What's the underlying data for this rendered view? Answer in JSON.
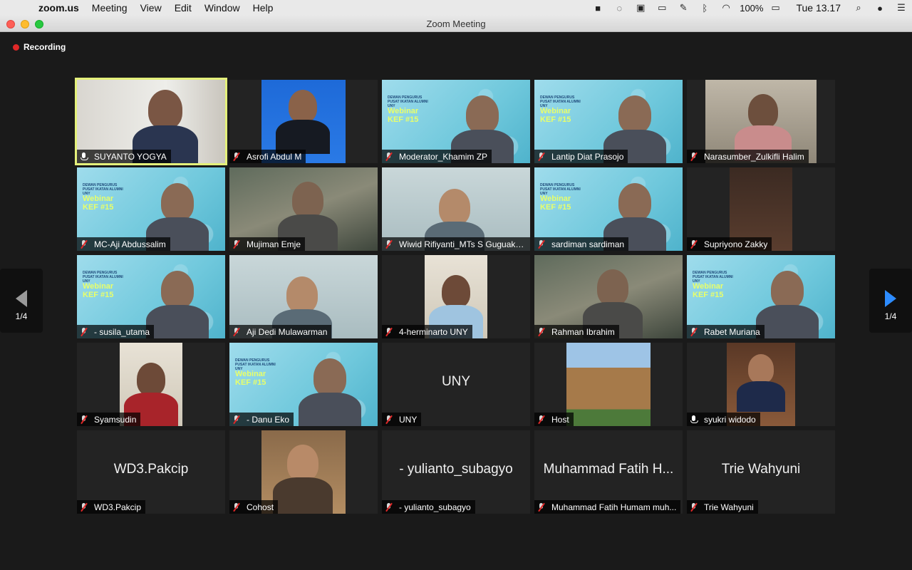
{
  "menubar": {
    "app_name": "zoom.us",
    "menus": [
      "Meeting",
      "View",
      "Edit",
      "Window",
      "Help"
    ],
    "battery": "100%",
    "clock": "Tue 13.17"
  },
  "window": {
    "title": "Zoom Meeting"
  },
  "meeting": {
    "recording_label": "Recording",
    "page_indicator_left": "1/4",
    "page_indicator_right": "1/4",
    "accent_active": "#e4f07a",
    "accent_nav": "#2d8cff",
    "participants": [
      {
        "name": "SUYANTO YOGYA",
        "muted": false,
        "video": "room"
      },
      {
        "name": "Asrofi Abdul M",
        "muted": true,
        "video": "portrait-blue"
      },
      {
        "name": "Moderator_Khamim ZP",
        "muted": true,
        "video": "webinar"
      },
      {
        "name": "Lantip Diat Prasojo",
        "muted": true,
        "video": "webinar"
      },
      {
        "name": "Narasumber_Zulkifli Halim",
        "muted": true,
        "video": "room-dark"
      },
      {
        "name": "MC-Aji Abdussalim",
        "muted": true,
        "video": "webinar"
      },
      {
        "name": "Mujiman Emje",
        "muted": true,
        "video": "outdoor"
      },
      {
        "name": "Wiwid Rifiyanti_MTs S Guguak Bulek",
        "muted": true,
        "video": "light"
      },
      {
        "name": "sardiman sardiman",
        "muted": true,
        "video": "webinar"
      },
      {
        "name": "Supriyono Zakky",
        "muted": true,
        "video": "dark-narrow"
      },
      {
        "name": "- susila_utama",
        "muted": true,
        "video": "webinar"
      },
      {
        "name": "Aji Dedi Mulawarman",
        "muted": true,
        "video": "light"
      },
      {
        "name": "4-herminarto UNY",
        "muted": true,
        "video": "narrow-light"
      },
      {
        "name": "Rahman Ibrahim",
        "muted": true,
        "video": "outdoor"
      },
      {
        "name": "Rabet Muriana",
        "muted": true,
        "video": "webinar"
      },
      {
        "name": "Syamsudin",
        "muted": true,
        "video": "narrow-light"
      },
      {
        "name": "- Danu Eko",
        "muted": true,
        "video": "webinar"
      },
      {
        "name": "UNY",
        "muted": true,
        "video": "none",
        "center_text": "UNY"
      },
      {
        "name": "Host",
        "muted": true,
        "video": "building"
      },
      {
        "name": "syukri widodo",
        "muted": false,
        "video": "portrait-photo"
      },
      {
        "name": "WD3.Pakcip",
        "muted": true,
        "video": "none",
        "center_text": "WD3.Pakcip"
      },
      {
        "name": "Cohost",
        "muted": true,
        "video": "narrow-warm"
      },
      {
        "name": "- yulianto_subagyo",
        "muted": true,
        "video": "none",
        "center_text": "- yulianto_subagyo"
      },
      {
        "name": "Muhammad Fatih Humam muh...",
        "muted": true,
        "video": "none",
        "center_text": "Muhammad Fatih H..."
      },
      {
        "name": "Trie Wahyuni",
        "muted": true,
        "video": "none",
        "center_text": "Trie Wahyuni"
      }
    ],
    "webinar_banner": {
      "small": "DEWAN PENGURUS PUSAT IKATAN ALUMNI UNY",
      "title": "Webinar",
      "subtitle": "KEF #15"
    }
  }
}
